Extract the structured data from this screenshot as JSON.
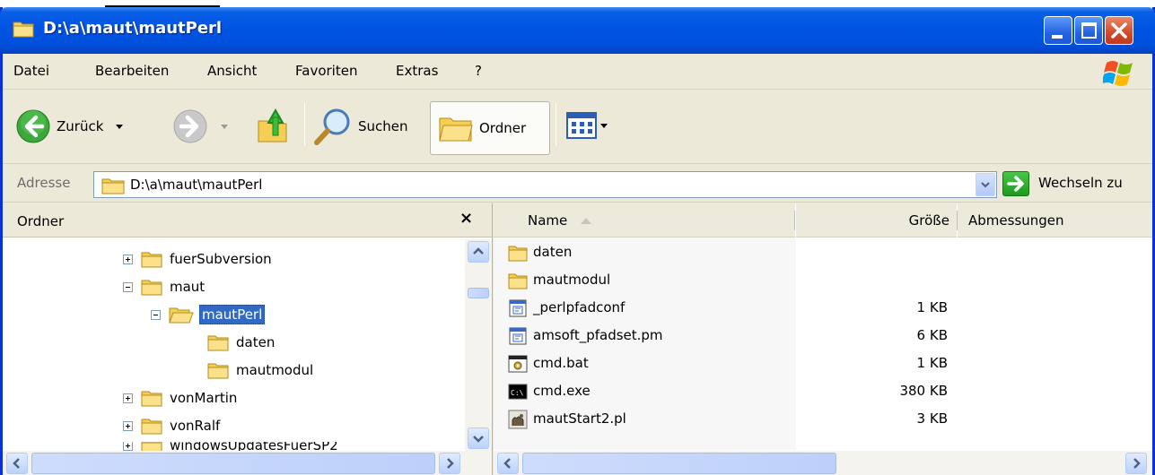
{
  "window": {
    "title": "D:\\a\\maut\\mautPerl"
  },
  "menu": {
    "items": [
      "Datei",
      "Bearbeiten",
      "Ansicht",
      "Favoriten",
      "Extras",
      "?"
    ]
  },
  "toolbar": {
    "back_label": "Zurück",
    "search_label": "Suchen",
    "folders_label": "Ordner"
  },
  "address": {
    "label": "Adresse",
    "value": "D:\\a\\maut\\mautPerl",
    "go_label": "Wechseln zu"
  },
  "folder_pane": {
    "title": "Ordner",
    "close_glyph": "×",
    "items": [
      {
        "label": "fuerSubversion",
        "expander": "plus"
      },
      {
        "label": "maut",
        "expander": "minus"
      },
      {
        "label": "mautPerl",
        "expander": "minus",
        "selected": true
      },
      {
        "label": "daten"
      },
      {
        "label": "mautmodul"
      },
      {
        "label": "vonMartin",
        "expander": "plus"
      },
      {
        "label": "vonRalf",
        "expander": "plus"
      },
      {
        "label": "windowsUpdatesFuerSP2",
        "expander": "plus"
      }
    ]
  },
  "file_list": {
    "columns": {
      "name": "Name",
      "size": "Größe",
      "dimensions": "Abmessungen"
    },
    "files": [
      {
        "name": "daten",
        "size": "",
        "icon": "folder-icon"
      },
      {
        "name": "mautmodul",
        "size": "",
        "icon": "folder-icon"
      },
      {
        "name": "_perlpfadconf",
        "size": "1 KB",
        "icon": "perl-file-icon"
      },
      {
        "name": "amsoft_pfadset.pm",
        "size": "6 KB",
        "icon": "perl-file-icon"
      },
      {
        "name": "cmd.bat",
        "size": "1 KB",
        "icon": "batch-file-icon"
      },
      {
        "name": "cmd.exe",
        "size": "380 KB",
        "icon": "console-exe-icon"
      },
      {
        "name": "mautStart2.pl",
        "size": "3 KB",
        "icon": "camel-perl-icon"
      }
    ]
  },
  "colors": {
    "titlebar": "#0054e3",
    "selection": "#316ac5",
    "chrome": "#ece9d8"
  }
}
